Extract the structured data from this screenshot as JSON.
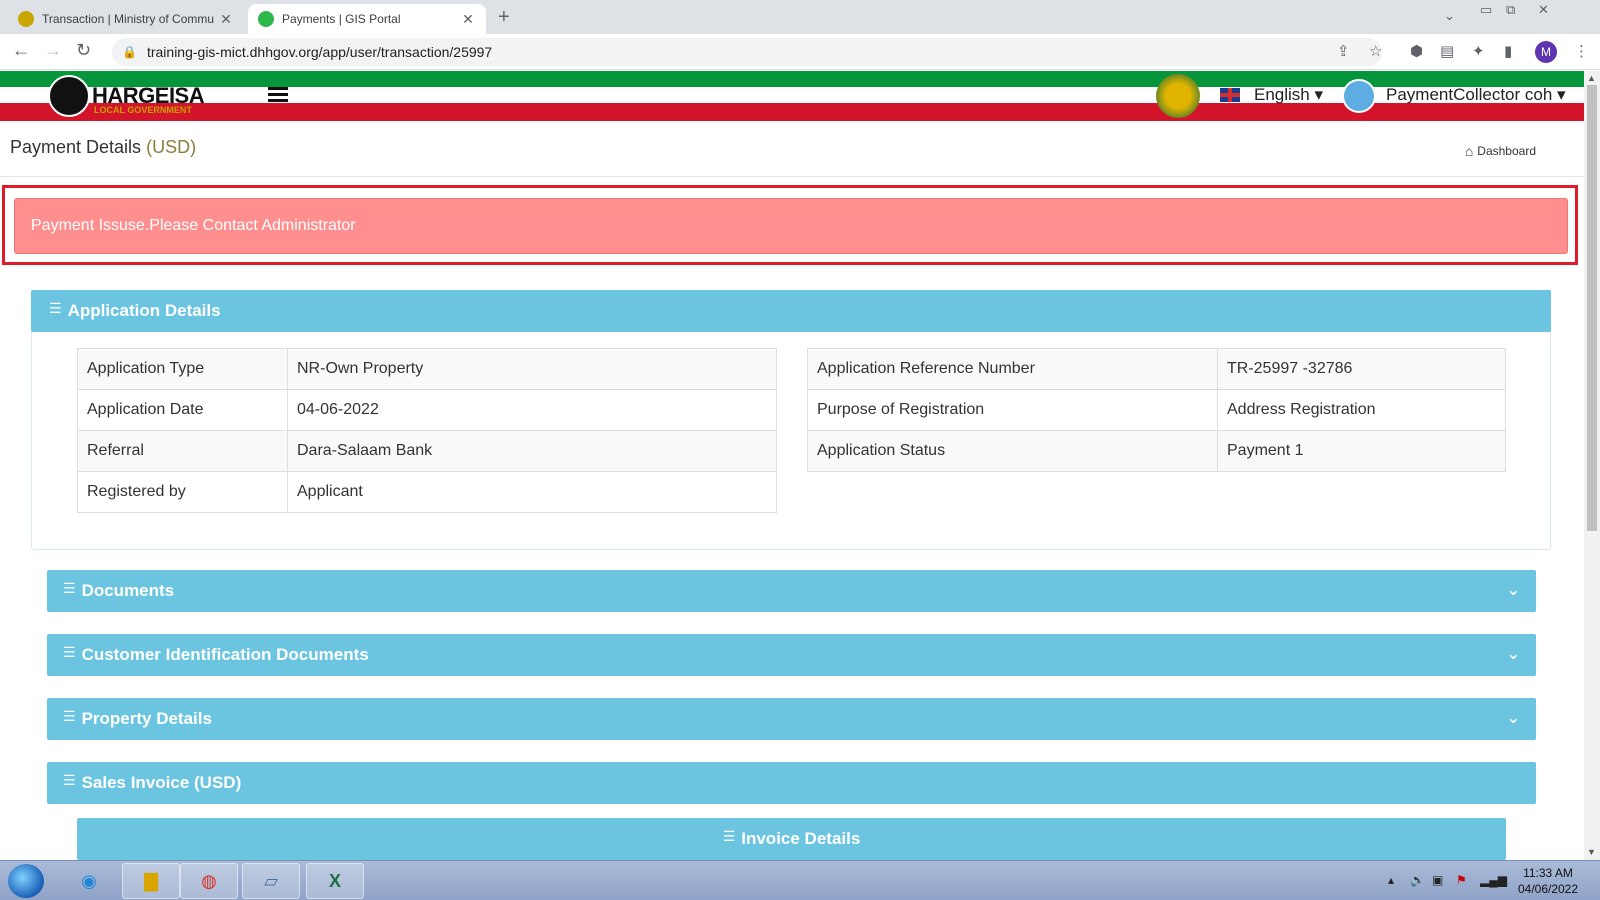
{
  "browser": {
    "tabs": [
      {
        "title": "Transaction | Ministry of Commu",
        "active": false
      },
      {
        "title": "Payments | GIS Portal",
        "active": true
      }
    ],
    "url": "training-gis-mict.dhhgov.org/app/user/transaction/25997",
    "profile_initial": "M"
  },
  "header": {
    "logo_text": "HARGEISA",
    "logo_sub": "LOCAL GOVERNMENT",
    "language": "English",
    "user_name": "PaymentCollector coh"
  },
  "page": {
    "title": "Payment Details",
    "currency": "(USD)",
    "breadcrumb": "Dashboard"
  },
  "alert": {
    "message": "Payment Issuse.Please Contact Administrator"
  },
  "application_details": {
    "heading": "Application Details",
    "left": [
      {
        "label": "Application Type",
        "value": "NR-Own Property"
      },
      {
        "label": "Application Date",
        "value": "04-06-2022"
      },
      {
        "label": "Referral",
        "value": "Dara-Salaam Bank"
      },
      {
        "label": "Registered by",
        "value": "Applicant"
      }
    ],
    "right": [
      {
        "label": "Application Reference Number",
        "value": "TR-25997 -32786"
      },
      {
        "label": "Purpose of Registration",
        "value": "Address Registration"
      },
      {
        "label": "Application Status",
        "value": "Payment 1"
      }
    ]
  },
  "sections": {
    "documents": "Documents",
    "customer_id_docs": "Customer Identification Documents",
    "property_details": "Property Details",
    "sales_invoice": "Sales Invoice (USD)",
    "invoice_details": "Invoice Details"
  },
  "taskbar": {
    "time": "11:33 AM",
    "date": "04/06/2022"
  },
  "colors": {
    "panel_header": "#6bc5e0",
    "alert_bg": "#ff8f8f",
    "alert_frame": "#e01b2a",
    "stripe_green": "#05963b",
    "stripe_red": "#d3142a"
  }
}
